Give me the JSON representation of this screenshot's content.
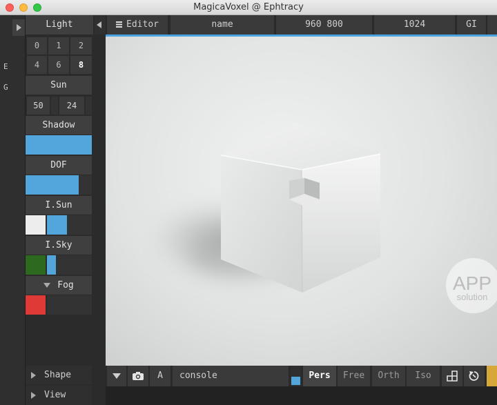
{
  "window": {
    "title": "MagicaVoxel @ Ephtracy"
  },
  "left_strip": {
    "letters": [
      "E",
      "G"
    ]
  },
  "panel": {
    "title": "Light",
    "number_grid": [
      "0",
      "1",
      "2",
      "4",
      "6",
      "8"
    ],
    "sun": {
      "label": "Sun",
      "value_a": "50",
      "value_b": "24"
    },
    "shadow": {
      "label": "Shadow",
      "level": 1.0
    },
    "dof": {
      "label": "DOF",
      "level": 0.8
    },
    "isun": {
      "label": "I.Sun",
      "swatch_color": "#ededed",
      "level": 0.45
    },
    "isky": {
      "label": "I.Sky",
      "swatch_color": "#2d6a1f",
      "level": 0.2
    },
    "fog": {
      "label": "Fog",
      "swatch_color": "#e03a37"
    },
    "sections": {
      "shape": "Shape",
      "view": "View"
    }
  },
  "topbar": {
    "editor": "Editor",
    "name": "name",
    "resolution": "960 800",
    "samples": "1024",
    "gi": "GI"
  },
  "bottombar": {
    "ambient": "A",
    "console": "console",
    "modes": [
      "Pers",
      "Free",
      "Orth",
      "Iso"
    ],
    "active_mode": "Pers"
  },
  "watermark": {
    "line1": "APP",
    "line2": "solution"
  },
  "colors": {
    "accent": "#52a6dc",
    "panel": "#3b3b3b",
    "background": "#2b2b2b"
  }
}
